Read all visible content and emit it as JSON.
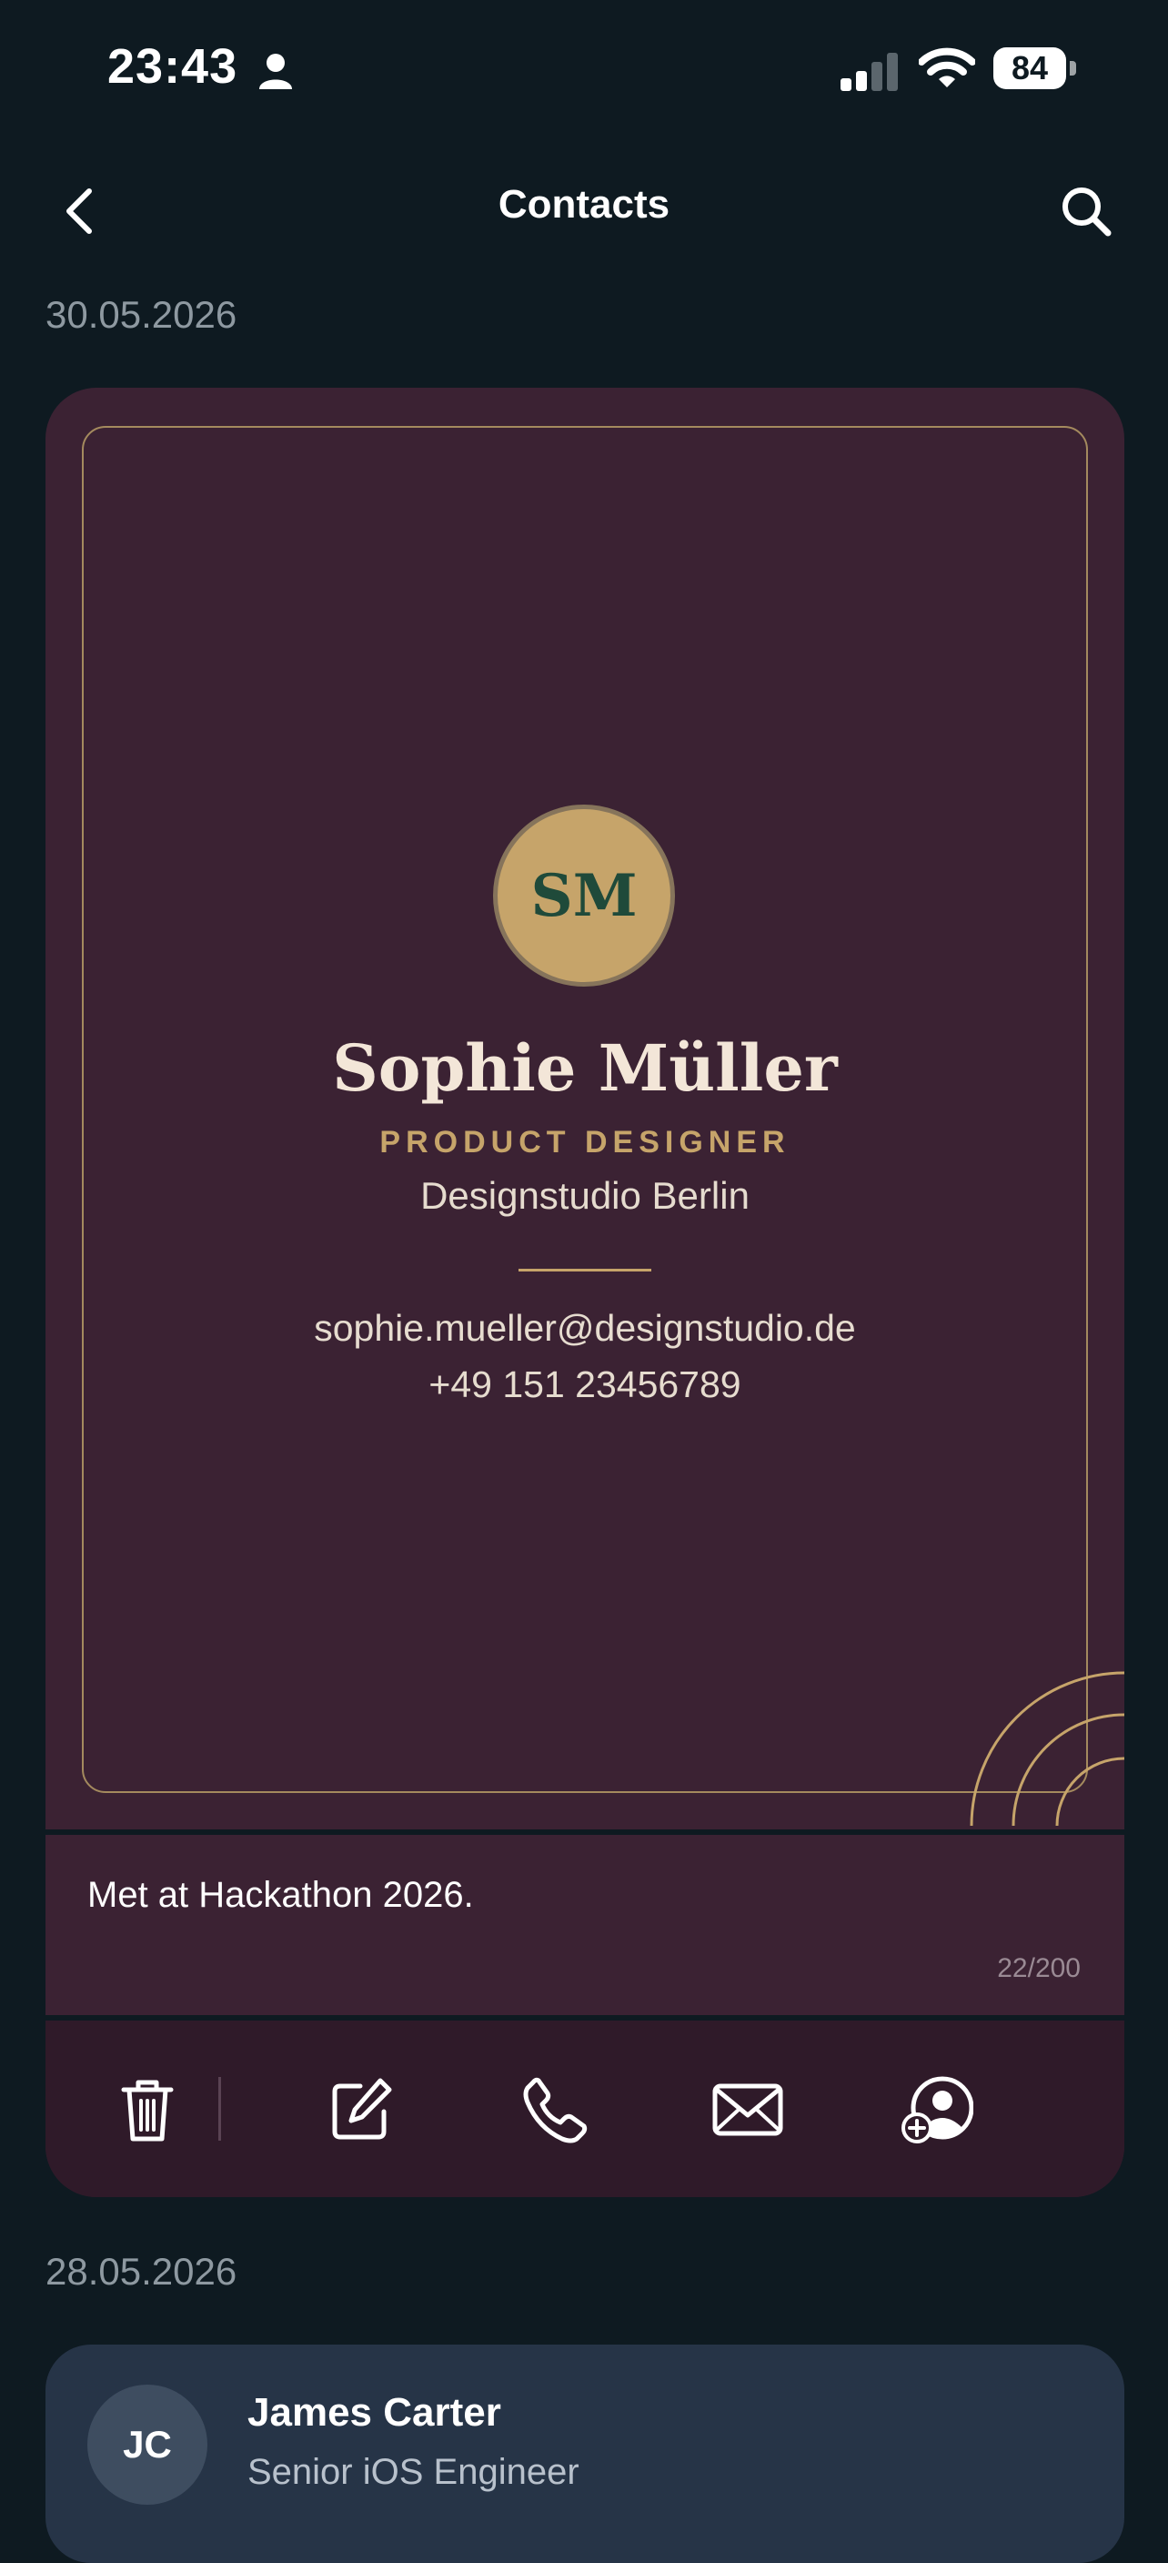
{
  "status_bar": {
    "time": "23:43",
    "battery": "84"
  },
  "nav": {
    "title": "Contacts"
  },
  "sections": [
    {
      "date": "30.05.2026"
    },
    {
      "date": "28.05.2026"
    }
  ],
  "card": {
    "initials": "SM",
    "name": "Sophie Müller",
    "title": "PRODUCT DESIGNER",
    "company": "Designstudio Berlin",
    "email": "sophie.mueller@designstudio.de",
    "phone": "+49 151 23456789",
    "note": "Met at Hackathon 2026.",
    "note_count": "22/200",
    "colors": {
      "background": "#3b2233",
      "accent": "#c6a46a",
      "initials": "#1f4a3a"
    }
  },
  "actions": [
    {
      "icon": "trash-icon"
    },
    {
      "icon": "edit-icon"
    },
    {
      "icon": "phone-icon"
    },
    {
      "icon": "mail-icon"
    },
    {
      "icon": "add-contact-icon"
    }
  ],
  "contact2": {
    "initials": "JC",
    "name": "James Carter",
    "role": "Senior iOS Engineer"
  }
}
